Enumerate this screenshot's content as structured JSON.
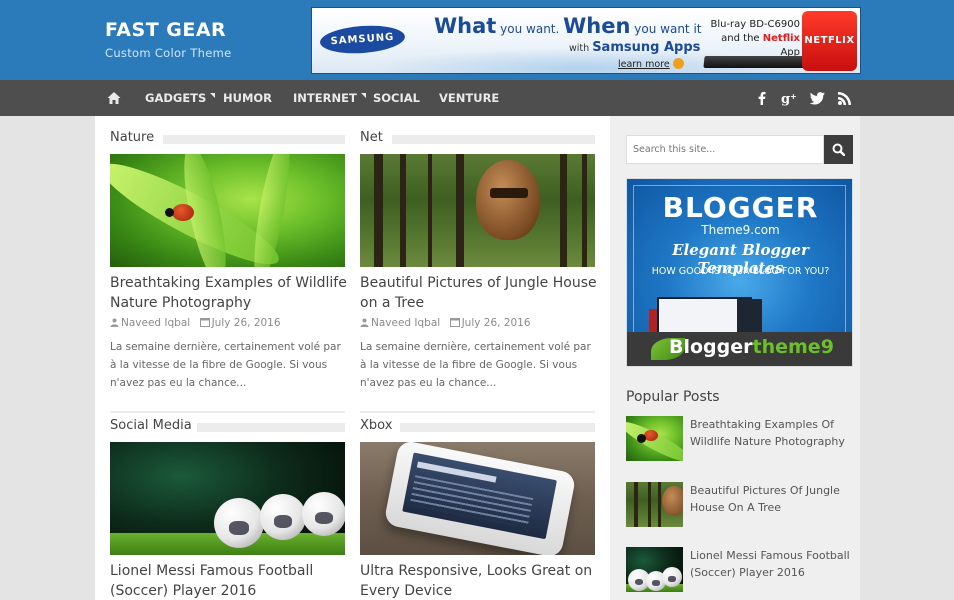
{
  "header": {
    "site_title": "FAST GEAR",
    "site_description": "Custom Color Theme",
    "colors": {
      "header_bg": "#2b7bba",
      "nav_bg": "#4e4e4e"
    },
    "ad": {
      "brand": "SAMSUNG",
      "headline_what": "What",
      "headline_mid": "you want.",
      "headline_when": "When",
      "headline_end": "you want it",
      "sub_prefix": "with",
      "sub_brand": "Samsung Apps",
      "learn_more": "learn more",
      "product_line1": "Blu-ray BD-C6900",
      "product_line2_prefix": "and the",
      "product_line2_brand": "Netflix",
      "product_line2_suffix": "App",
      "badge": "NETFLIX"
    }
  },
  "nav": {
    "home_icon": "home-icon",
    "items": [
      {
        "label": "GADGETS",
        "has_dropdown": true
      },
      {
        "label": "HUMOR",
        "has_dropdown": false
      },
      {
        "label": "INTERNET",
        "has_dropdown": true
      },
      {
        "label": "SOCIAL",
        "has_dropdown": false
      },
      {
        "label": "VENTURE",
        "has_dropdown": false
      }
    ],
    "social": [
      {
        "icon": "facebook-icon",
        "glyph": "f"
      },
      {
        "icon": "google-plus-icon",
        "glyph": "g+"
      },
      {
        "icon": "twitter-icon",
        "glyph": "t"
      },
      {
        "icon": "rss-icon",
        "glyph": "rss"
      }
    ]
  },
  "posts": [
    {
      "category": "Nature",
      "title": "Breathtaking Examples of Wildlife Nature Photography",
      "author": "Naveed Iqbal",
      "date": "July 26, 2016",
      "excerpt": "La semaine dernière, certainement volé par à la vitesse de la fibre de Google. Si vous n'avez pas eu la chance..."
    },
    {
      "category": "Net",
      "title": "Beautiful Pictures of Jungle House on a Tree",
      "author": "Naveed Iqbal",
      "date": "July 26, 2016",
      "excerpt": "La semaine dernière, certainement volé par à la vitesse de la fibre de Google. Si vous n'avez pas eu la chance..."
    },
    {
      "category": "Social Media",
      "title": "Lionel Messi Famous Football (Soccer) Player 2016"
    },
    {
      "category": "Xbox",
      "title": "Ultra Responsive, Looks Great on Every Device"
    }
  ],
  "sidebar": {
    "search_placeholder": "Search this site...",
    "ad": {
      "title": "BLOGGER",
      "domain": "Theme9.com",
      "tagline": "Elegant Blogger Templates",
      "question": "HOW GOOD IS YOUR BLOG FOR YOU?",
      "brand_a": "Blogger",
      "brand_b": "theme9"
    },
    "popular_title": "Popular Posts",
    "popular": [
      {
        "title": "Breathtaking Examples Of Wildlife Nature Photography"
      },
      {
        "title": "Beautiful Pictures Of Jungle House On A Tree"
      },
      {
        "title": "Lionel Messi Famous Football (Soccer) Player 2016"
      }
    ]
  }
}
